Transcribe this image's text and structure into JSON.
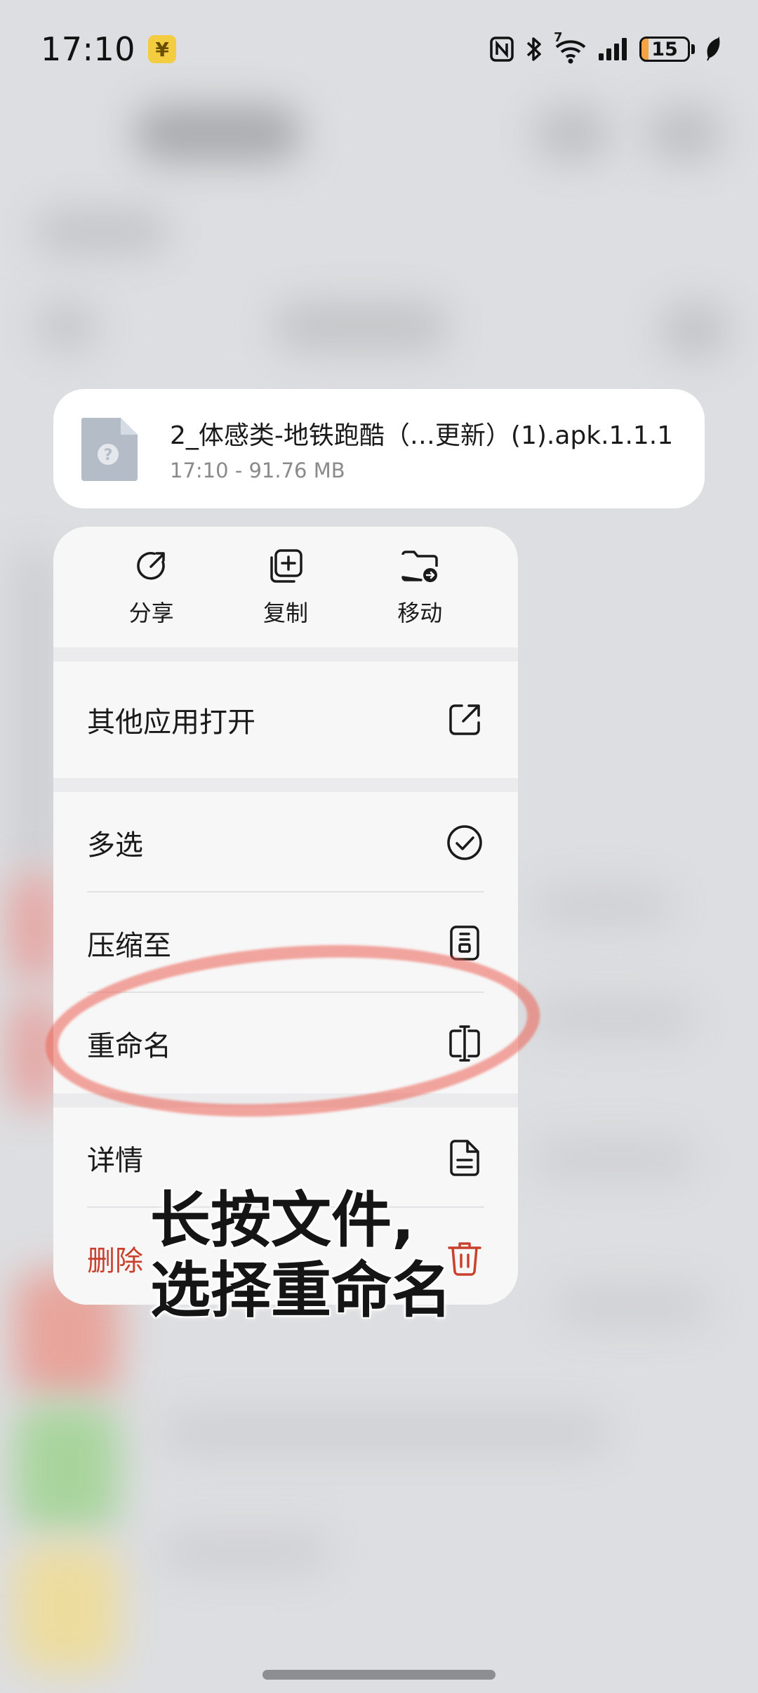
{
  "status_bar": {
    "time": "17:10",
    "battery_level": "15",
    "battery_fraction": 0.15,
    "signal_label": "7"
  },
  "file": {
    "name": "2_体感类-地铁跑酷（…更新）(1).apk.1.1.1",
    "meta": "17:10 - 91.76 MB"
  },
  "quick_actions": [
    {
      "label": "分享",
      "icon": "share-icon"
    },
    {
      "label": "复制",
      "icon": "copy-icon"
    },
    {
      "label": "移动",
      "icon": "move-folder-icon"
    }
  ],
  "menu": {
    "open_with": "其他应用打开",
    "multi_select": "多选",
    "compress": "压缩至",
    "rename": "重命名",
    "details": "详情",
    "delete": "删除"
  },
  "caption": {
    "line1": "长按文件,",
    "line2": "选择重命名"
  },
  "colors": {
    "accent_danger": "#c9412c",
    "highlight": "#ec6052",
    "battery_fill": "#f4a340",
    "badge": "#f4cc3f"
  }
}
